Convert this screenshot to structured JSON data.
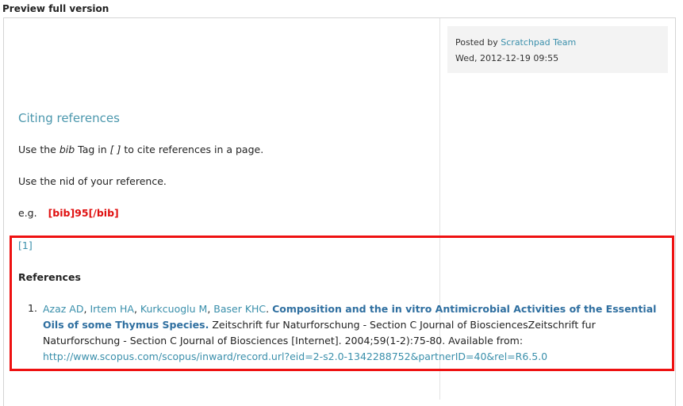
{
  "header": {
    "label": "Preview full version"
  },
  "meta": {
    "posted_by_prefix": "Posted by",
    "author": "Scratchpad Team",
    "date": "Wed, 2012-12-19 09:55"
  },
  "content": {
    "title": "Citing references",
    "p1": {
      "before": "Use the",
      "tag": "bib",
      "middle": "Tag in",
      "brackets": "[ ]",
      "after": "to cite references in a page."
    },
    "p2": "Use the nid of your reference.",
    "p3": {
      "eg": "e.g.",
      "example": "[bib]95[/bib]"
    },
    "cite_link": "[1]",
    "references_heading": "References",
    "reference": {
      "number": "1.",
      "authors": [
        "Azaz AD",
        "Irtem HA",
        "Kurkcuoglu M",
        "Baser KHC"
      ],
      "title": "Composition and the in vitro Antimicrobial Activities of the Essential Oils of some Thymus Species.",
      "details": "Zeitschrift fur Naturforschung - Section C Journal of BiosciencesZeitschrift fur Naturforschung - Section C Journal of Biosciences [Internet]. 2004;59(1-2):75-80. Available from:",
      "url": "http://www.scopus.com/scopus/inward/record.url?eid=2-s2.0-1342288752&partnerID=40&rel=R6.5.0"
    }
  }
}
